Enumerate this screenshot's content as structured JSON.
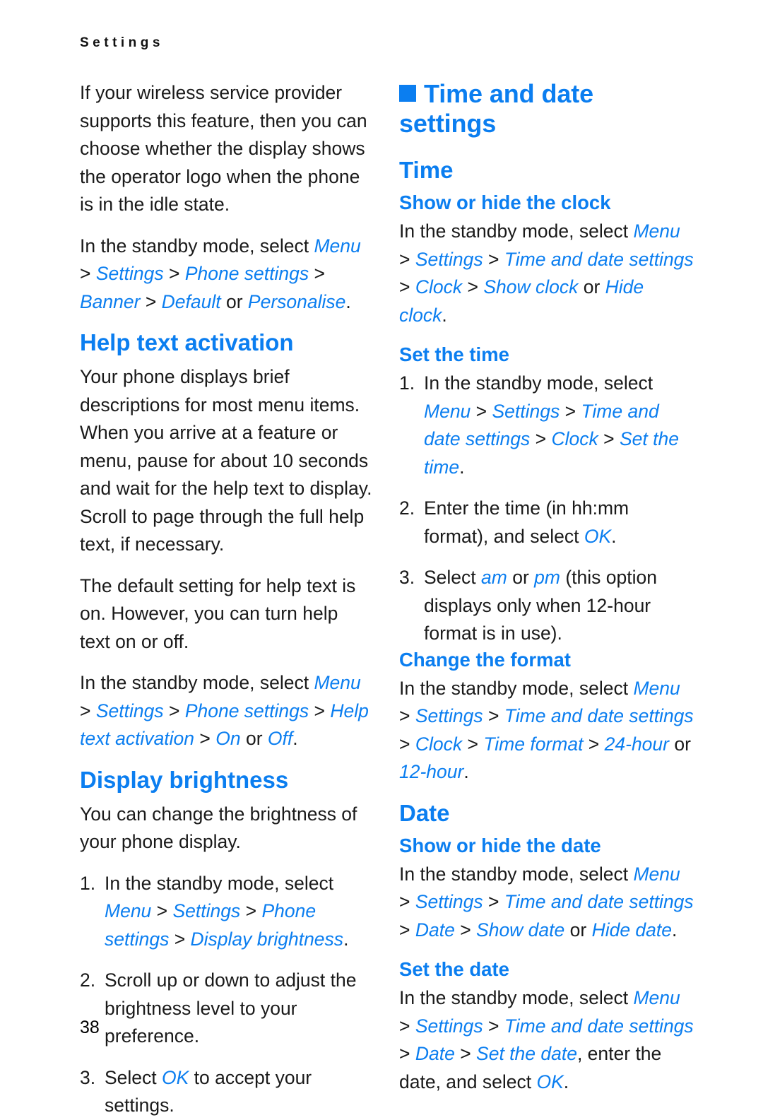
{
  "page": {
    "running_header": "S e t t i n g s",
    "running_header_plain": "Settings",
    "page_number": "38",
    "accent_color": "#0b7ef0",
    "text_color": "#1a1a1a"
  },
  "left_column": {
    "intro_paragraph": "If your wireless service provider supports this feature, then you can choose whether the display shows the operator logo when the phone is in the idle state.",
    "banner_path": {
      "lead": "In the standby mode, select ",
      "terms": [
        "Menu",
        "Settings",
        "Phone settings",
        "Banner",
        "Default"
      ],
      "or_word": " or ",
      "alt_term": "Personalise",
      "end": "."
    },
    "help_heading": "Help text activation",
    "help_paragraph_1": "Your phone displays brief descriptions for most menu items. When you arrive at a feature or menu, pause for about 10 seconds and wait for the help text to display. Scroll to page through the full help text, if necessary.",
    "help_paragraph_2": "The default setting for help text is on. However, you can turn help text on or off.",
    "help_path": {
      "lead": "In the standby mode, select ",
      "terms": [
        "Menu",
        "Settings",
        "Phone settings",
        "Help text activation",
        "On"
      ],
      "or_word": " or ",
      "alt_term": "Off",
      "end": "."
    },
    "brightness_heading": "Display brightness",
    "brightness_paragraph": "You can change the brightness of your phone display.",
    "brightness_steps": [
      {
        "num": "1.",
        "lead": "In the standby mode, select ",
        "terms": [
          "Menu",
          "Settings",
          "Phone settings",
          "Display brightness"
        ],
        "end": "."
      },
      {
        "num": "2.",
        "text": "Scroll up or down to adjust the brightness level to your preference."
      },
      {
        "num": "3.",
        "lead": "Select ",
        "term": "OK",
        "tail": " to accept your settings."
      }
    ]
  },
  "right_column": {
    "chapter_heading": "Time and date settings",
    "time_heading": "Time",
    "show_hide_clock_heading": "Show or hide the clock",
    "show_hide_clock_path": {
      "lead": "In the standby mode, select ",
      "terms": [
        "Menu",
        "Settings",
        "Time and date settings",
        "Clock",
        "Show clock"
      ],
      "or_word": " or ",
      "alt_term": "Hide clock",
      "end": "."
    },
    "set_time_heading": "Set the time",
    "set_time_steps": [
      {
        "num": "1.",
        "lead": "In the standby mode, select ",
        "terms": [
          "Menu",
          "Settings",
          "Time and date settings",
          "Clock",
          "Set the time"
        ],
        "end": "."
      },
      {
        "num": "2.",
        "lead": "Enter the time (in hh:mm format), and select ",
        "term": "OK",
        "tail": "."
      },
      {
        "num": "3.",
        "lead": "Select ",
        "term": "am",
        "mid": " or ",
        "term2": "pm",
        "tail": " (this option displays only when 12-hour format is in use)."
      }
    ],
    "change_format_heading": "Change the format",
    "change_format_path": {
      "lead": "In the standby mode, select ",
      "terms": [
        "Menu",
        "Settings",
        "Time and date settings",
        "Clock",
        "Time format",
        "24-hour"
      ],
      "or_word": " or ",
      "alt_term": "12-hour",
      "end": "."
    },
    "date_heading": "Date",
    "show_hide_date_heading": "Show or hide the date",
    "show_hide_date_path": {
      "lead": "In the standby mode, select ",
      "terms": [
        "Menu",
        "Settings",
        "Time and date settings",
        "Date",
        "Show date"
      ],
      "or_word": " or ",
      "alt_term": "Hide date",
      "end": "."
    },
    "set_date_heading": "Set the date",
    "set_date_path": {
      "lead": "In the standby mode, select ",
      "terms": [
        "Menu",
        "Settings",
        "Time and date settings",
        "Date",
        "Set the date"
      ],
      "tail": ", enter the date, and select ",
      "final_term": "OK",
      "end": "."
    }
  }
}
